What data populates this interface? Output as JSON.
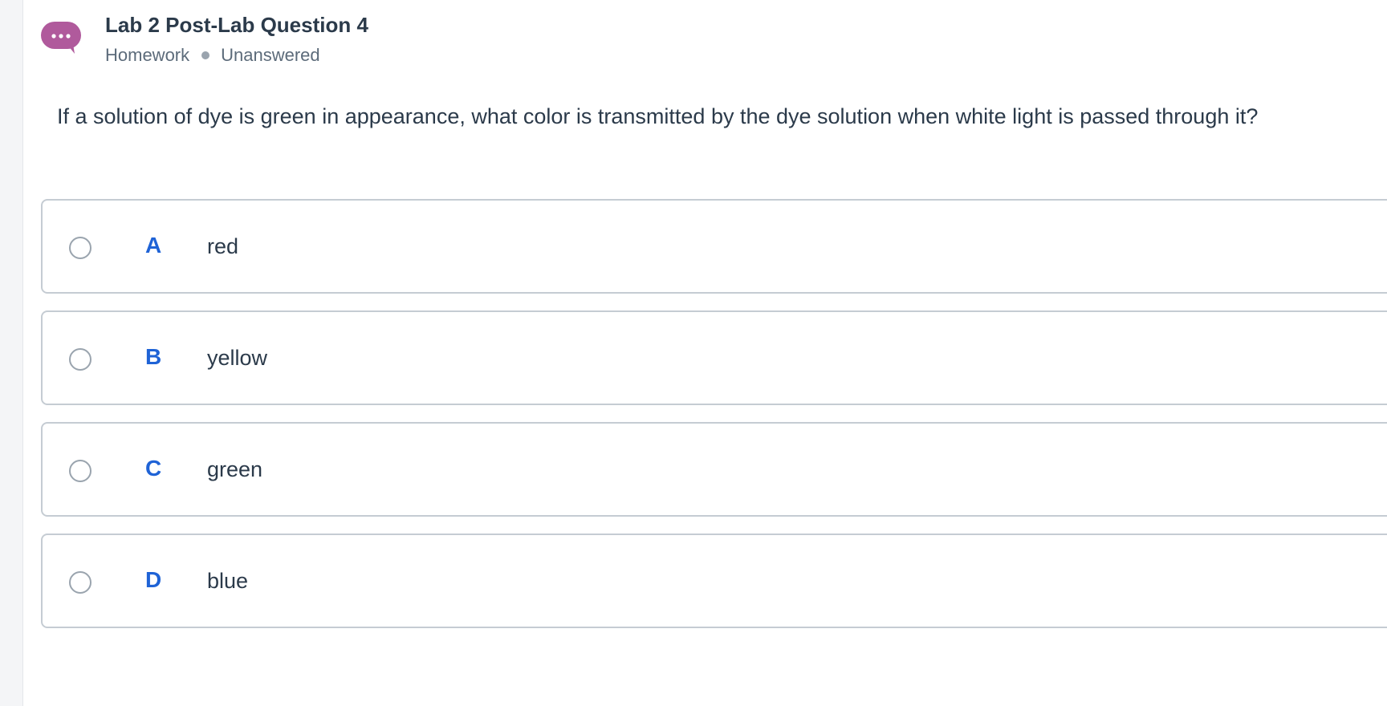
{
  "header": {
    "title": "Lab 2 Post-Lab Question 4",
    "type": "Homework",
    "status": "Unanswered",
    "icon": "chat-bubble-icon",
    "icon_color": "#b05a9c"
  },
  "question": {
    "text": "If a solution of dye is green in appearance, what color is transmitted by the dye solution when white light is passed through it?"
  },
  "options": [
    {
      "letter": "A",
      "text": "red"
    },
    {
      "letter": "B",
      "text": "yellow"
    },
    {
      "letter": "C",
      "text": "green"
    },
    {
      "letter": "D",
      "text": "blue"
    }
  ],
  "colors": {
    "accent": "#1f63d6",
    "text": "#2b3a4a",
    "muted": "#5c6b7a",
    "border": "#c5ccd3"
  }
}
